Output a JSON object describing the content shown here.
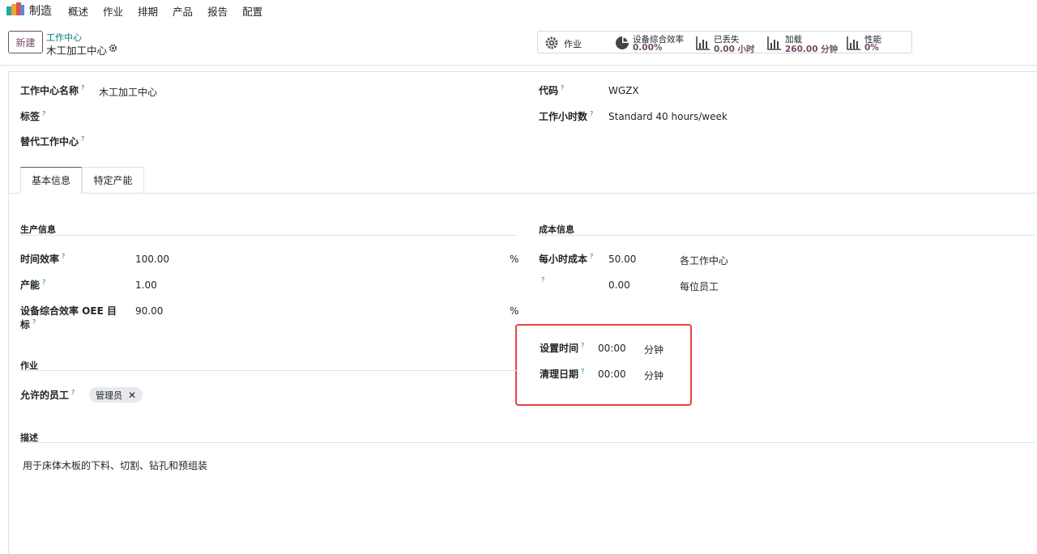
{
  "nav": {
    "app_name": "制造",
    "menu": [
      "概述",
      "作业",
      "排期",
      "产品",
      "报告",
      "配置"
    ]
  },
  "control": {
    "new_button": "新建",
    "breadcrumb_parent": "工作中心",
    "breadcrumb_current": "木工加工中心"
  },
  "smart_buttons": {
    "operations": {
      "label": "作业"
    },
    "oee": {
      "label": "设备综合效率",
      "value": "0.00%"
    },
    "lost": {
      "label": "已丢失",
      "value": "0.00 小时"
    },
    "load": {
      "label": "加载",
      "value": "260.00 分钟"
    },
    "performance": {
      "label": "性能",
      "value": "0%"
    }
  },
  "form": {
    "name_label": "工作中心名称",
    "name_value": "木工加工中心",
    "tags_label": "标签",
    "alt_label": "替代工作中心",
    "code_label": "代码",
    "code_value": "WGZX",
    "hours_label": "工作小时数",
    "hours_value": "Standard 40 hours/week"
  },
  "tabs": [
    "基本信息",
    "特定产能"
  ],
  "production": {
    "title": "生产信息",
    "time_eff_label": "时间效率",
    "time_eff_value": "100.00",
    "time_eff_unit": "%",
    "capacity_label": "产能",
    "capacity_value": "1.00",
    "oee_label_line1": "设备综合效率 OEE 目",
    "oee_label_line2": "标",
    "oee_value": "90.00",
    "oee_unit": "%"
  },
  "cost": {
    "title": "成本信息",
    "hourly_label": "每小时成本",
    "hourly_value": "50.00",
    "hourly_unit": "各工作中心",
    "employee_value": "0.00",
    "employee_unit": "每位员工",
    "setup_label": "设置时间",
    "setup_value": "00:00",
    "setup_unit": "分钟",
    "cleanup_label": "清理日期",
    "cleanup_value": "00:00",
    "cleanup_unit": "分钟"
  },
  "operations": {
    "title": "作业",
    "employees_label": "允许的员工",
    "tag": "管理员"
  },
  "description": {
    "title": "描述",
    "text": "用于床体木板的下料、切割、钻孔和预组装"
  },
  "colors": {
    "brand": "#714b67",
    "link": "#017e84",
    "highlight": "#e5443f"
  }
}
